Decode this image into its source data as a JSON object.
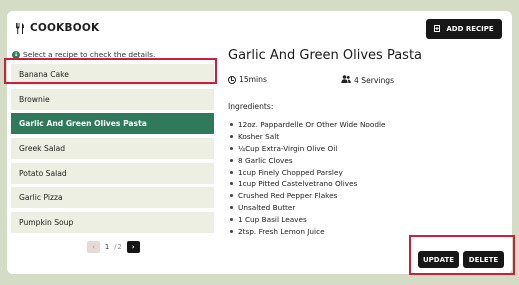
{
  "header": {
    "title": "COOKBOOK",
    "add_button_label": "ADD RECIPE"
  },
  "sidebar": {
    "hint": "Select a recipe to check the details.",
    "recipes": [
      {
        "label": "Banana Cake",
        "selected": false
      },
      {
        "label": "Brownie",
        "selected": false
      },
      {
        "label": "Garlic And Green Olives Pasta",
        "selected": true
      },
      {
        "label": "Greek Salad",
        "selected": false
      },
      {
        "label": "Potato Salad",
        "selected": false
      },
      {
        "label": "Garlic Pizza",
        "selected": false
      },
      {
        "label": "Pumpkin Soup",
        "selected": false
      }
    ],
    "pagination": {
      "current": "1",
      "separator": "/",
      "total": "2"
    }
  },
  "detail": {
    "title": "Garlic And Green Olives Pasta",
    "time": "15mins",
    "servings": "4 Servings",
    "ingredients_label": "Ingredients:",
    "ingredients": [
      "12oz. Pappardelle Or Other Wide Noodle",
      "Kosher Salt",
      "¼Cup Extra-Virgin Olive Oil",
      "8 Garlic Cloves",
      "1cup Finely Chopped Parsley",
      "1cup Pitted Castelvetrano Olives",
      "Crushed Red Pepper Flakes",
      "Unsalted Butter",
      "1 Cup Basil Leaves",
      "2tsp. Fresh Lemon Juice"
    ]
  },
  "actions": {
    "update_label": "UPDATE",
    "delete_label": "DELETE"
  },
  "colors": {
    "background": "#d4dcc5",
    "selected_row": "#2f7a5a",
    "row": "#ecefe2",
    "button": "#171717",
    "highlight_frame": "#c9213d"
  }
}
